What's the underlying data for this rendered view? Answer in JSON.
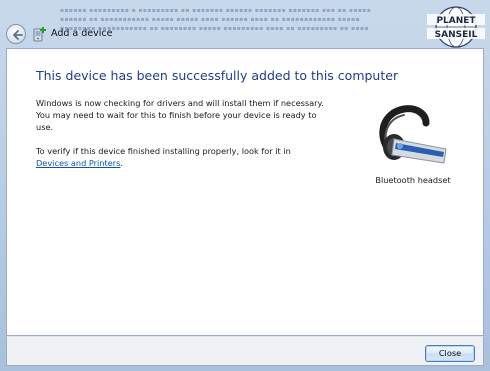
{
  "titlebar": {
    "title": "Add a device"
  },
  "logo": {
    "line1": "PLANET",
    "line2": "SANSEIL"
  },
  "content": {
    "heading": "This device has been successfully added to this computer",
    "para1": "Windows is now checking for drivers and will install them if necessary. You may need to wait for this to finish before your device is ready to use.",
    "para2_prefix": "To verify if this device finished installing properly, look for it in",
    "para2_link": "Devices and Printers",
    "para2_suffix": ".",
    "device_label": "Bluetooth headset",
    "device_icon": "bluetooth-headset-icon"
  },
  "footer": {
    "close_label": "Close"
  },
  "colors": {
    "heading": "#1e3d8c",
    "link": "#0a54b3",
    "frame": "#b5cbe4"
  }
}
